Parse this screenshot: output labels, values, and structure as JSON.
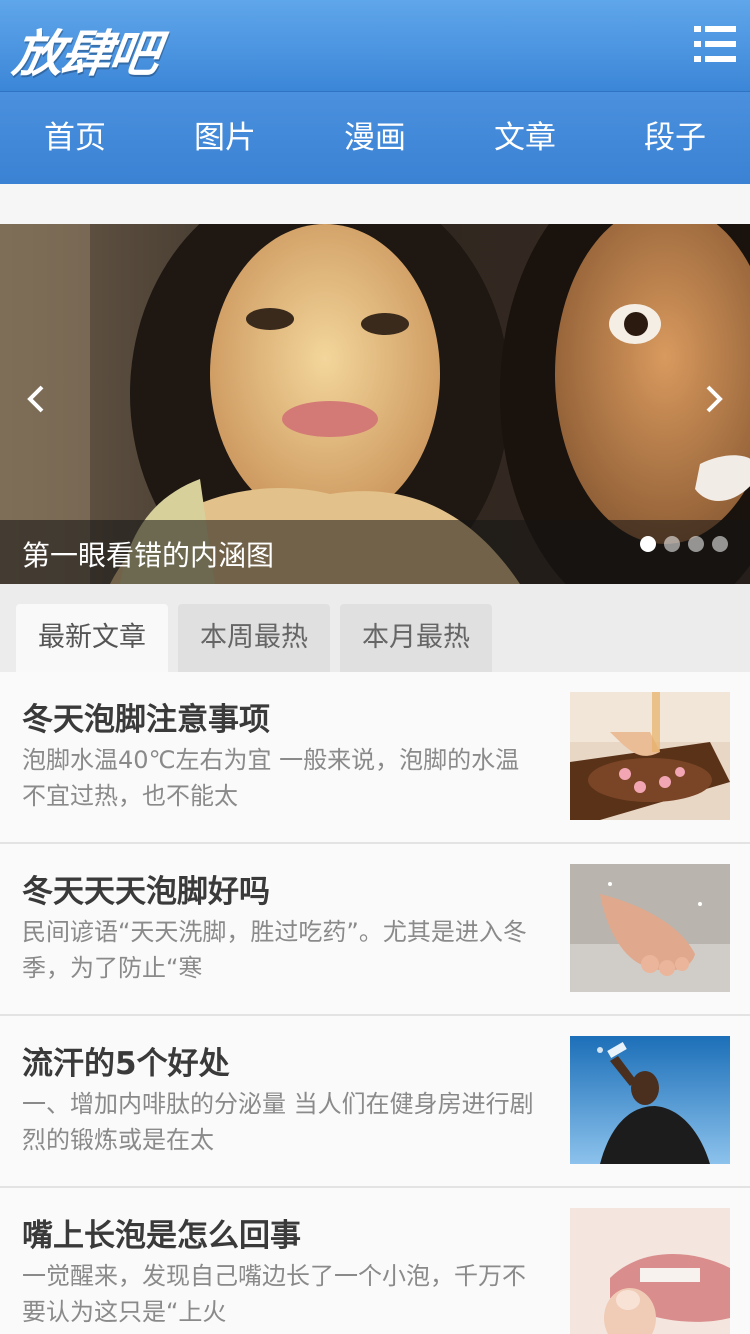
{
  "header": {
    "logo": "放肆吧",
    "menu_icon": "list-menu-icon"
  },
  "nav": [
    "首页",
    "图片",
    "漫画",
    "文章",
    "段子"
  ],
  "slider": {
    "caption": "第一眼看错的内涵图",
    "dots_total": 4,
    "active_index": 0
  },
  "tabs": [
    "最新文章",
    "本周最热",
    "本月最热"
  ],
  "active_tab": 0,
  "articles": [
    {
      "title": "冬天泡脚注意事项",
      "summary": "泡脚水温40℃左右为宜 一般来说，泡脚的水温不宜过热，也不能太"
    },
    {
      "title": "冬天天天泡脚好吗",
      "summary": "民间谚语“天天洗脚，胜过吃药”。尤其是进入冬季，为了防止“寒"
    },
    {
      "title": "流汗的5个好处",
      "summary": "一、增加内啡肽的分泌量 当人们在健身房进行剧烈的锻炼或是在太"
    },
    {
      "title": "嘴上长泡是怎么回事",
      "summary": "一觉醒来，发现自己嘴边长了一个小泡，千万不要认为这只是“上火"
    }
  ]
}
